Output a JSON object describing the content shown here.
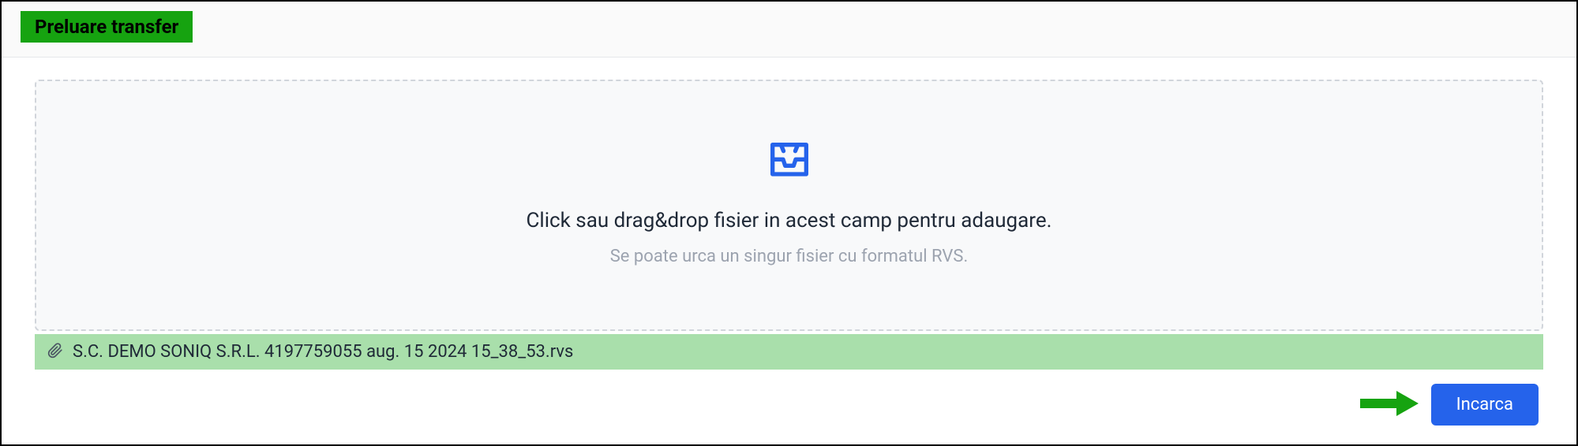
{
  "header": {
    "title": "Preluare transfer"
  },
  "dropzone": {
    "main_text": "Click sau drag&drop fisier in acest camp pentru adaugare.",
    "sub_text": "Se poate urca un singur fisier cu formatul RVS."
  },
  "uploaded_file": {
    "name": "S.C. DEMO SONIQ S.R.L. 4197759055 aug. 15 2024 15_38_53.rvs"
  },
  "actions": {
    "upload_label": "Incarca"
  }
}
